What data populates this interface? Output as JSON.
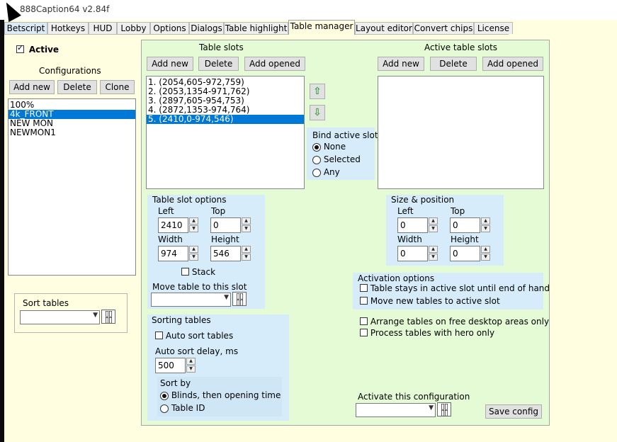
{
  "window": {
    "title": "888Caption64 v2.84f"
  },
  "tabs": [
    "Betscript",
    "Hotkeys",
    "HUD",
    "Lobby",
    "Options",
    "Dialogs",
    "Table highlight",
    "Table manager",
    "Layout editor",
    "Convert chips",
    "License"
  ],
  "left": {
    "active_label": "Active",
    "configurations_label": "Configurations",
    "buttons": {
      "add_new": "Add new",
      "delete": "Delete",
      "clone": "Clone"
    },
    "configs": [
      "100%",
      "4k_FRONT",
      "NEW MON",
      "NEWMON1"
    ],
    "selected_config": "4k_FRONT",
    "sort_tables_label": "Sort tables"
  },
  "table_slots": {
    "heading": "Table slots",
    "buttons": {
      "add_new": "Add new",
      "delete": "Delete",
      "add_opened": "Add opened"
    },
    "items": [
      "1. (2054,605-972,759)",
      "2. (2053,1354-971,762)",
      "3. (2897,605-954,753)",
      "4. (2872,1353-974,764)",
      "5. (2410,0-974,546)"
    ],
    "selected": "5. (2410,0-974,546)"
  },
  "active_table_slots": {
    "heading": "Active table slots",
    "buttons": {
      "add_new": "Add new",
      "delete": "Delete",
      "add_opened": "Add opened"
    }
  },
  "bind_active_slot": {
    "label": "Bind active slot",
    "options": [
      "None",
      "Selected",
      "Any"
    ],
    "selected": "None"
  },
  "slot_options": {
    "heading": "Table slot options",
    "left_label": "Left",
    "left_value": "2410",
    "top_label": "Top",
    "top_value": "0",
    "width_label": "Width",
    "width_value": "974",
    "height_label": "Height",
    "height_value": "546",
    "stack_label": "Stack",
    "move_label": "Move table to this slot"
  },
  "size_position": {
    "heading": "Size & position",
    "left_label": "Left",
    "left_value": "0",
    "top_label": "Top",
    "top_value": "0",
    "width_label": "Width",
    "width_value": "0",
    "height_label": "Height",
    "height_value": "0"
  },
  "activation": {
    "heading": "Activation options",
    "stays": "Table stays in active slot until end of hand",
    "move_new": "Move new tables to active slot",
    "arrange": "Arrange tables on free desktop areas only",
    "hero_only": "Process tables with hero only"
  },
  "sorting": {
    "heading": "Sorting tables",
    "auto_sort": "Auto sort tables",
    "delay_label": "Auto sort delay, ms",
    "delay_value": "500",
    "sort_by_label": "Sort by",
    "sort_options": [
      "Blinds, then opening time",
      "Table ID"
    ],
    "sort_selected": "Blinds, then opening time"
  },
  "activate_config_label": "Activate this configuration",
  "save_config": "Save config",
  "icons": {
    "up": "arrow-up-icon",
    "down": "arrow-down-icon",
    "cards": "cards-icon"
  }
}
